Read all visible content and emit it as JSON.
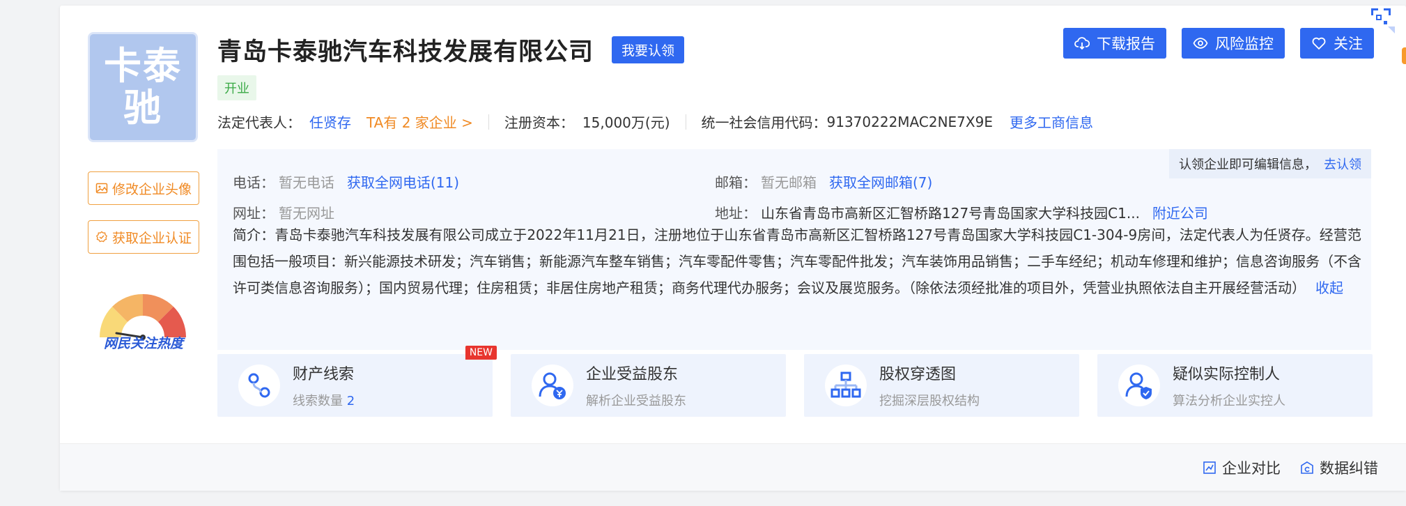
{
  "company": {
    "logo_text": "卡泰驰",
    "name": "青岛卡泰驰汽车科技发展有限公司",
    "claim_label": "我要认领",
    "status": "开业"
  },
  "sidebar": {
    "change_logo_label": "修改企业头像",
    "get_cert_label": "获取企业认证",
    "heat_label": "网民关注热度",
    "heat_level": 0.35
  },
  "actions": {
    "download_label": "下载报告",
    "monitor_label": "风险监控",
    "follow_label": "关注"
  },
  "basic": {
    "legal_rep_label": "法定代表人：",
    "legal_rep": "任贤存",
    "other_companies": "TA有 2 家企业 >",
    "capital_label": "注册资本：",
    "capital": "15,000万(元)",
    "credit_code_label": "统一社会信用代码：",
    "credit_code": "91370222MAC2NE7X9E",
    "more_link": "更多工商信息"
  },
  "details": {
    "claim_hint": "认领企业即可编辑信息，",
    "claim_hint_link": "去认领",
    "phone_label": "电话：",
    "phone": "暂无电话",
    "phone_link": "获取全网电话(11)",
    "email_label": "邮箱：",
    "email": "暂无邮箱",
    "email_link": "获取全网邮箱(7)",
    "website_label": "网址：",
    "website": "暂无网址",
    "address_label": "地址：",
    "address": "山东省青岛市高新区汇智桥路127号青岛国家大学科技园C1...",
    "nearby_link": "附近公司",
    "intro_label": "简介：",
    "intro": "青岛卡泰驰汽车科技发展有限公司成立于2022年11月21日，注册地位于山东省青岛市高新区汇智桥路127号青岛国家大学科技园C1-304-9房间，法定代表人为任贤存。经营范围包括一般项目：新兴能源技术研发；汽车销售；新能源汽车整车销售；汽车零配件零售；汽车零配件批发；汽车装饰用品销售；二手车经纪；机动车修理和维护；信息咨询服务（不含许可类信息咨询服务）；国内贸易代理；住房租赁；非居住房地产租赁；商务代理代办服务；会议及展览服务。（除依法须经批准的项目外，凭营业执照依法自主开展经营活动）",
    "collapse_link": "收起"
  },
  "features": [
    {
      "title": "财产线索",
      "sub": "线索数量 ",
      "count": "2",
      "badge": "NEW"
    },
    {
      "title": "企业受益股东",
      "sub": "解析企业受益股东"
    },
    {
      "title": "股权穿透图",
      "sub": "挖掘深层股权结构"
    },
    {
      "title": "疑似实际控制人",
      "sub": "算法分析企业实控人"
    }
  ],
  "footer": {
    "compare_label": "企业对比",
    "correct_label": "数据纠错"
  },
  "colors": {
    "primary": "#2f68f0",
    "orange": "#f08a24",
    "status_green": "#3aaa46"
  }
}
